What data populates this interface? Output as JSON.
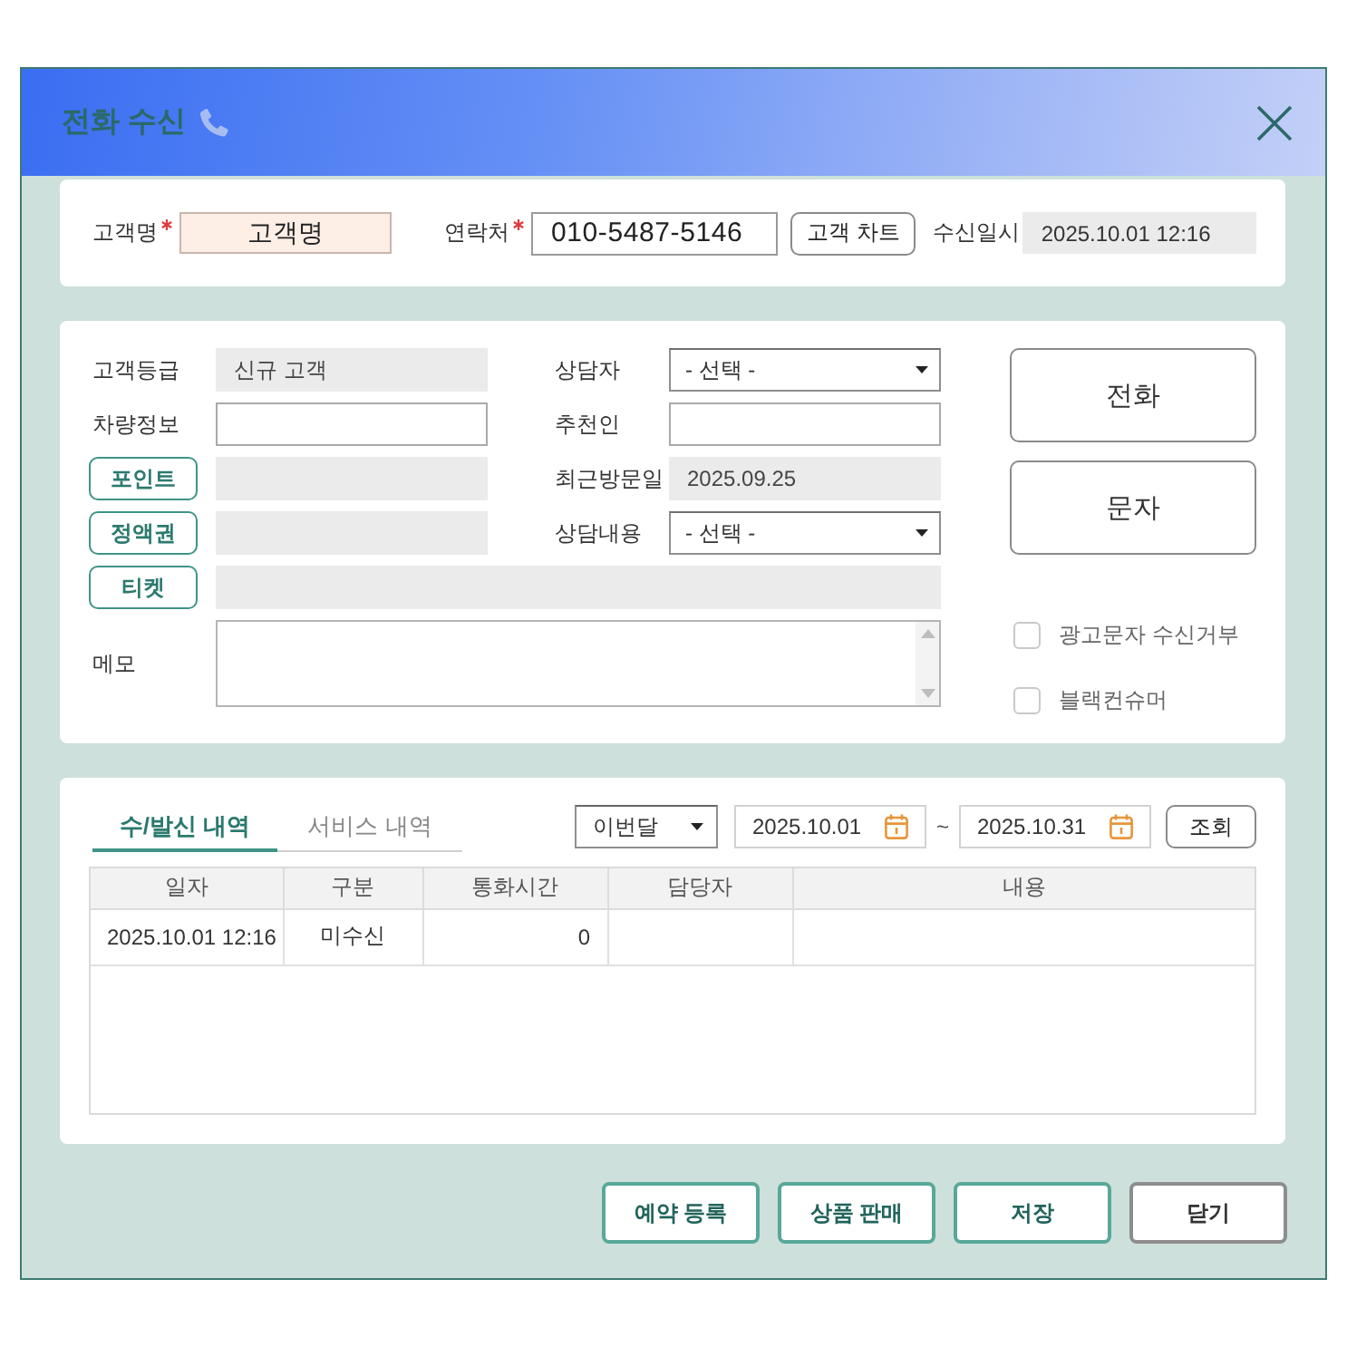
{
  "window": {
    "title": "전화 수신"
  },
  "customer": {
    "fields": [
      {
        "kind": "name",
        "label": "고객명",
        "required": true,
        "value": "고객명"
      },
      {
        "kind": "phone",
        "label": "연락처",
        "required": true,
        "value": "010-5487-5146"
      }
    ],
    "chart_button": "고객 차트",
    "received": {
      "label": "수신일시",
      "value": "2025.10.01 12:16"
    }
  },
  "details": {
    "rows": [
      {
        "cells": [
          {
            "label": {
              "kind": "text",
              "text": "고객등급"
            },
            "field": {
              "kind": "readonly",
              "value": "신규 고객"
            }
          },
          {
            "label": {
              "kind": "text",
              "text": "상담자"
            },
            "field": {
              "kind": "select",
              "value": "- 선택 -"
            }
          }
        ]
      },
      {
        "cells": [
          {
            "label": {
              "kind": "text",
              "text": "차량정보"
            },
            "field": {
              "kind": "input"
            }
          },
          {
            "label": {
              "kind": "text",
              "text": "추천인"
            },
            "field": {
              "kind": "input"
            }
          }
        ]
      },
      {
        "cells": [
          {
            "label": {
              "kind": "button",
              "text": "포인트"
            },
            "field": {
              "kind": "readonly"
            }
          },
          {
            "label": {
              "kind": "text",
              "text": "최근방문일"
            },
            "field": {
              "kind": "readonly",
              "value": "2025.09.25"
            }
          }
        ]
      },
      {
        "cells": [
          {
            "label": {
              "kind": "button",
              "text": "정액권"
            },
            "field": {
              "kind": "readonly"
            }
          },
          {
            "label": {
              "kind": "text",
              "text": "상담내용"
            },
            "field": {
              "kind": "select",
              "value": "- 선택 -"
            }
          }
        ]
      },
      {
        "cells": [
          {
            "label": {
              "kind": "button",
              "text": "티켓"
            },
            "field": {
              "kind": "readonly"
            }
          }
        ]
      },
      {
        "cells": [
          {
            "label": {
              "kind": "text",
              "text": "메모"
            },
            "field": {
              "kind": "textarea"
            }
          }
        ]
      }
    ],
    "actions": [
      "전화",
      "문자"
    ],
    "options": [
      {
        "label": "광고문자 수신거부",
        "checked": false
      },
      {
        "label": "블랙컨슈머",
        "checked": false
      }
    ]
  },
  "history": {
    "tabs": [
      {
        "label": "수/발신 내역",
        "selected": true
      },
      {
        "label": "서비스 내역",
        "selected": false
      }
    ],
    "period": "이번달",
    "date_from": "2025.10.01",
    "range_separator": "~",
    "date_to": "2025.10.31",
    "search_button": "조회",
    "table": {
      "columns": [
        {
          "label": "일자",
          "kind": "text"
        },
        {
          "label": "구분",
          "kind": "text"
        },
        {
          "label": "통화시간",
          "kind": "number"
        },
        {
          "label": "담당자",
          "kind": "text"
        },
        {
          "label": "내용",
          "kind": "text"
        }
      ],
      "rows": [
        {
          "cells": [
            "2025.10.01 12:16",
            "미수신",
            "0"
          ]
        }
      ]
    }
  },
  "footer": {
    "buttons": [
      {
        "label": "예약 등록",
        "kind": "primary"
      },
      {
        "label": "상품 판매",
        "kind": "primary"
      },
      {
        "label": "저장",
        "kind": "primary"
      },
      {
        "label": "닫기",
        "kind": "secondary"
      }
    ]
  }
}
